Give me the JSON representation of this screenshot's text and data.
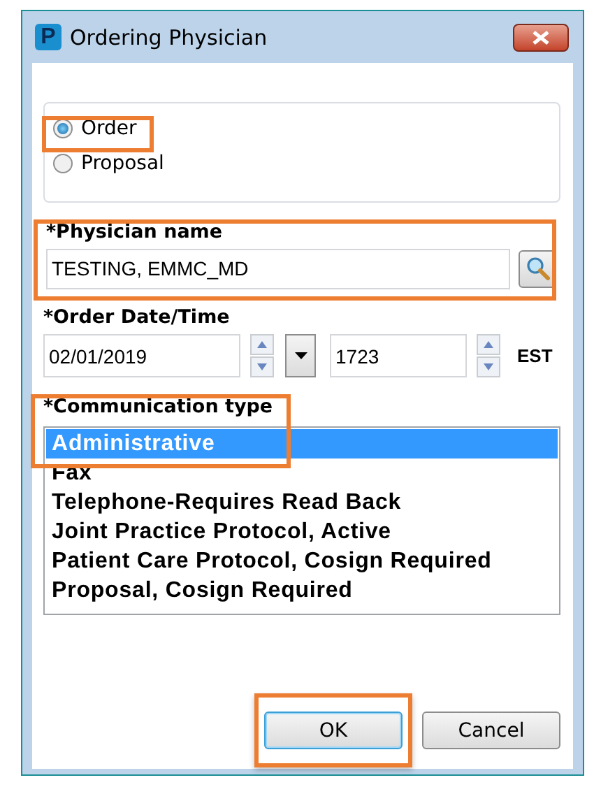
{
  "window": {
    "title": "Ordering Physician",
    "app_icon": "P"
  },
  "order_type": {
    "options": [
      {
        "label": "Order",
        "selected": true,
        "highlighted": true
      },
      {
        "label": "Proposal",
        "selected": false,
        "highlighted": false
      }
    ]
  },
  "physician": {
    "label": "*Physician name",
    "value": "TESTING, EMMC_MD",
    "highlighted": true
  },
  "order_datetime": {
    "label": "*Order Date/Time",
    "date": "02/01/2019",
    "time": "1723",
    "timezone": "EST"
  },
  "communication": {
    "label": "*Communication type",
    "highlighted": true,
    "items": [
      {
        "label": "Administrative",
        "selected": true
      },
      {
        "label": "Fax",
        "selected": false
      },
      {
        "label": "Telephone-Requires Read Back",
        "selected": false
      },
      {
        "label": "Joint Practice Protocol, Active",
        "selected": false
      },
      {
        "label": "Patient Care Protocol, Cosign Required",
        "selected": false
      },
      {
        "label": "Proposal, Cosign Required",
        "selected": false
      }
    ]
  },
  "buttons": [
    {
      "label": "OK",
      "default": true,
      "highlighted": true
    },
    {
      "label": "Cancel",
      "default": false,
      "highlighted": false
    }
  ]
}
